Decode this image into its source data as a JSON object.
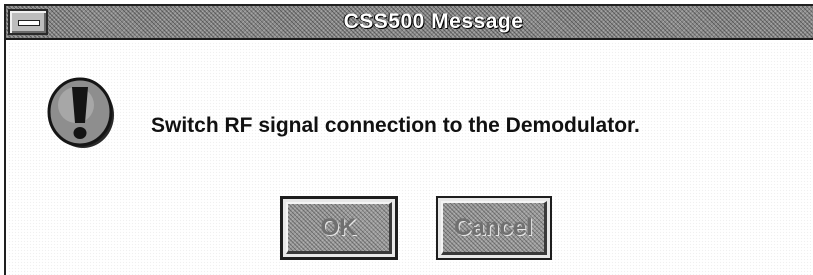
{
  "window": {
    "title": "CSS500 Message"
  },
  "dialog": {
    "icon": "exclamation-icon",
    "message": "Switch RF signal connection to the Demodulator."
  },
  "buttons": {
    "ok_label": "OK",
    "cancel_label": "Cancel"
  },
  "colors": {
    "title_text": "#ffffff",
    "titlebar": "#8a8a8a",
    "button_face": "#9a9a9a",
    "button_text": "#707070",
    "frame": "#202020"
  }
}
